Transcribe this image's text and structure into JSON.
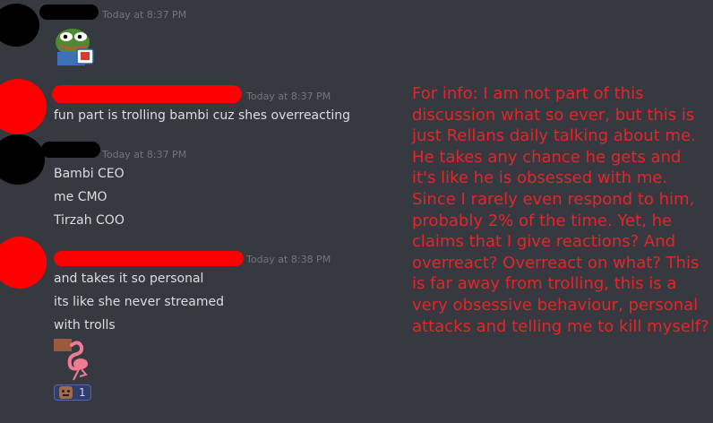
{
  "messages": [
    {
      "timestamp": "Today at 8:37 PM",
      "lines": [],
      "attachments": [
        "pepe-emote"
      ]
    },
    {
      "timestamp": "Today at 8:37 PM",
      "lines": [
        "fun part is trolling bambi cuz shes overreacting"
      ]
    },
    {
      "timestamp": "Today at 8:37 PM",
      "lines": [
        "Bambi CEO",
        "me CMO",
        "Tirzah COO"
      ]
    },
    {
      "timestamp": "Today at 8:38 PM",
      "lines": [
        "and takes it so personal",
        "its like she never streamed",
        "with trolls"
      ],
      "attachments": [
        "flamingo-emote"
      ],
      "reaction": {
        "icon": "face-emoji-icon",
        "count": "1"
      }
    }
  ],
  "annotation": {
    "text": "For info: I am not part of this discussion what so ever, but this is just Rellans daily talking about me. He takes any chance he gets and it's like he is obsessed with me. Since I rarely even respond to him, probably 2% of the time. Yet, he claims that I give reactions? And overreact? Overreact on what? This is far away from trolling, this is a very obsessive behaviour, personal attacks and telling me to kill myself?",
    "color": "#e3262a"
  },
  "colors": {
    "background": "#36393f",
    "text": "#dcddde",
    "timestamp": "#72767d",
    "censor_red": "#ff0000",
    "reaction_bg": "#2f3e6b"
  }
}
